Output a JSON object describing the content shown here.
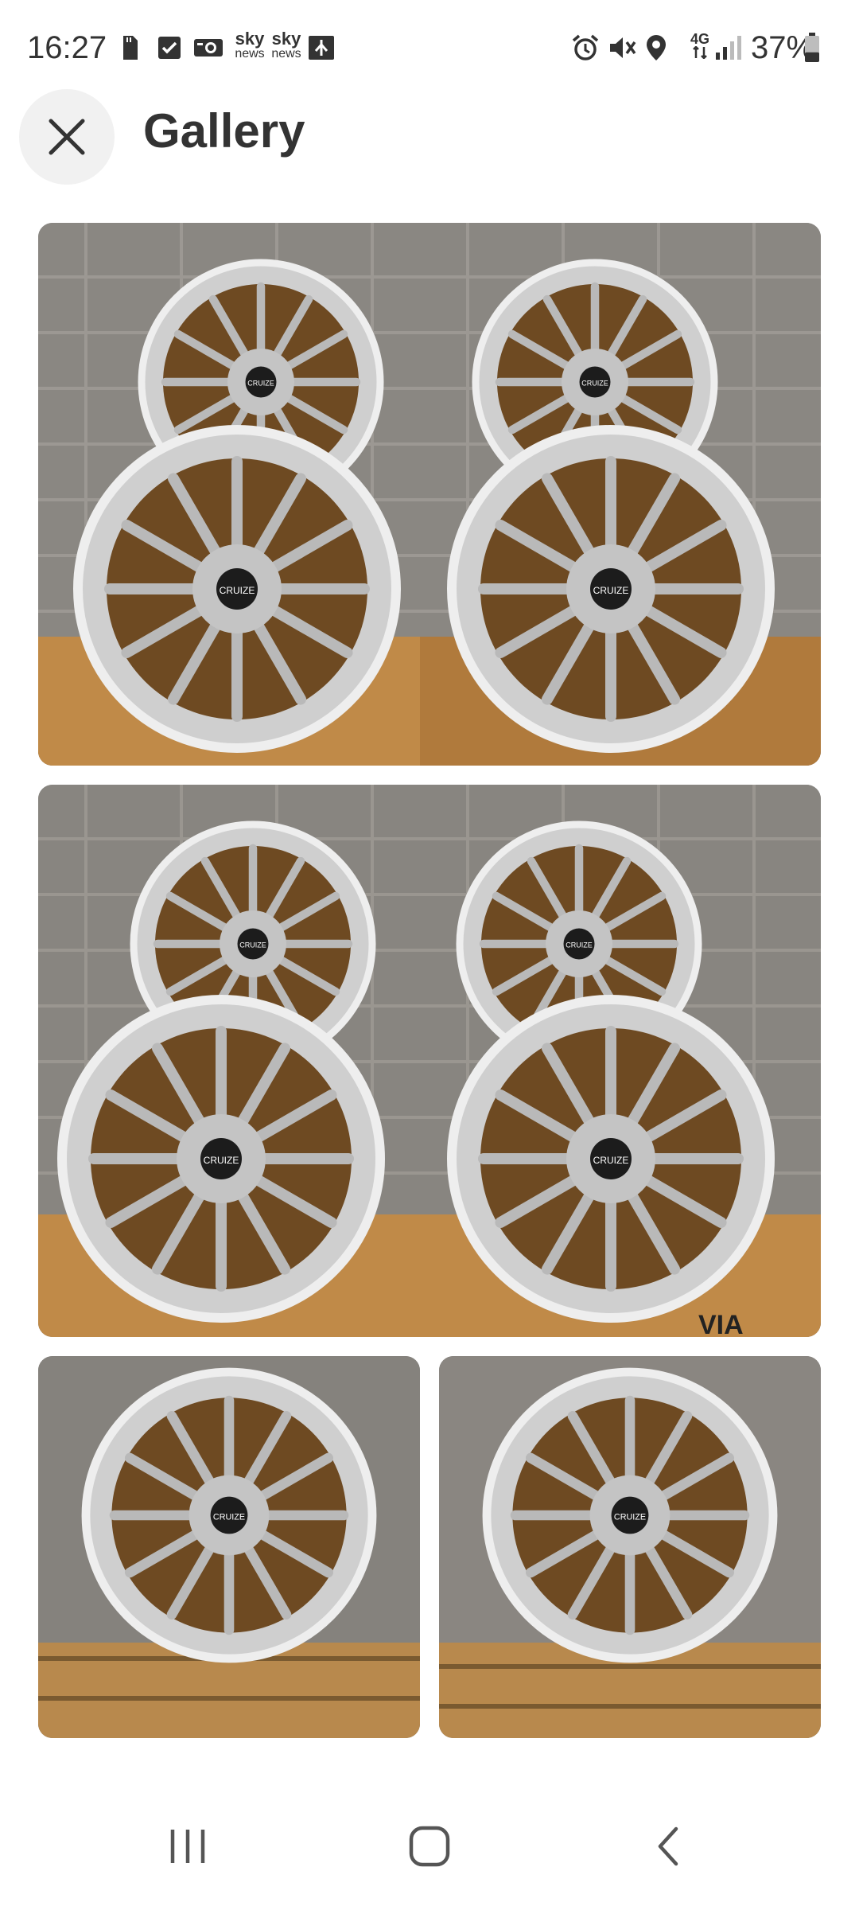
{
  "status_bar": {
    "time": "16:27",
    "notification_icons": [
      "sim-card-icon",
      "checkbox-icon",
      "camera-news-icon",
      "sky-news-icon",
      "sky-news-icon",
      "mirror-icon"
    ],
    "sky_news_1": {
      "line1": "sky",
      "line2": "news"
    },
    "sky_news_2": {
      "line1": "sky",
      "line2": "news"
    },
    "system_icons": [
      "alarm-icon",
      "mute-icon",
      "location-icon",
      "4g-icon",
      "signal-icon",
      "battery-icon"
    ],
    "network": "4G",
    "battery": "37%",
    "battery_level": 0.37
  },
  "header": {
    "title": "Gallery",
    "close_icon": "close-icon"
  },
  "gallery": {
    "images": [
      {
        "description_icon": "alloy-wheels-photo",
        "index": 1
      },
      {
        "description_icon": "alloy-wheels-photo",
        "index": 2
      },
      {
        "description_icon": "alloy-wheel-photo",
        "index": 3
      },
      {
        "description_icon": "alloy-wheel-photo",
        "index": 4
      }
    ],
    "wheel_center_label": "CRUIZE",
    "box_label": "VIA"
  },
  "nav_bar": {
    "recents_icon": "recents-icon",
    "home_icon": "home-icon",
    "back_icon": "back-icon"
  }
}
